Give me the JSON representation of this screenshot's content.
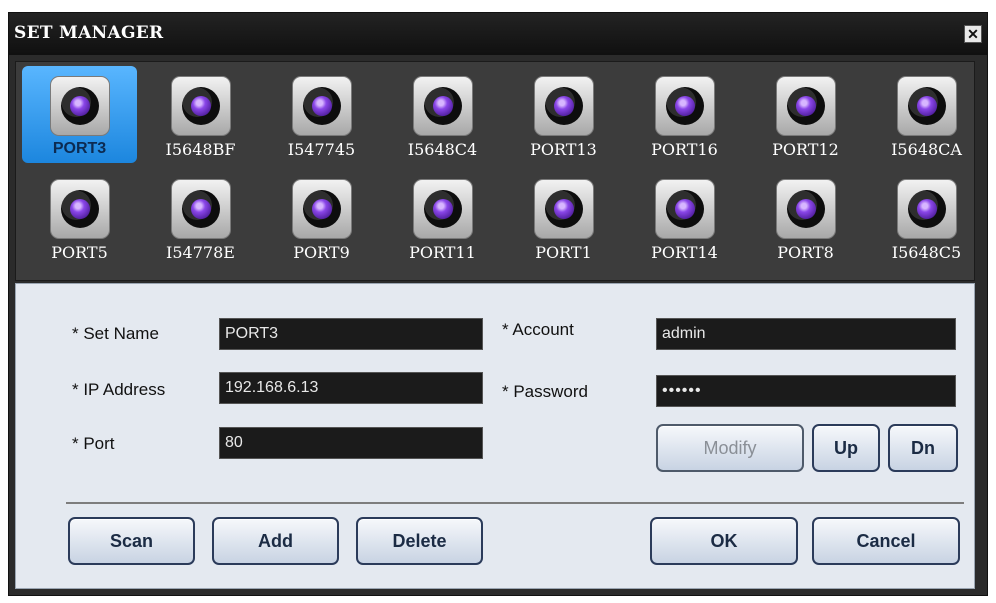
{
  "window": {
    "title": "SET MANAGER",
    "close_icon": "close-icon"
  },
  "devices": [
    {
      "label": "PORT3",
      "selected": true
    },
    {
      "label": "I5648BF"
    },
    {
      "label": "I547745"
    },
    {
      "label": "I5648C4"
    },
    {
      "label": "PORT13"
    },
    {
      "label": "PORT16"
    },
    {
      "label": "PORT12"
    },
    {
      "label": "I5648CA"
    },
    {
      "label": "PORT5"
    },
    {
      "label": "I54778E"
    },
    {
      "label": "PORT9"
    },
    {
      "label": "PORT11"
    },
    {
      "label": "PORT1"
    },
    {
      "label": "PORT14"
    },
    {
      "label": "PORT8"
    },
    {
      "label": "I5648C5"
    }
  ],
  "form": {
    "set_name_label": "* Set Name",
    "set_name_value": "PORT3",
    "ip_label": "* IP Address",
    "ip_value": "192.168.6.13",
    "port_label": "* Port",
    "port_value": "80",
    "account_label": "* Account",
    "account_value": "admin",
    "password_label": "* Password",
    "password_value": "••••••"
  },
  "buttons": {
    "modify": "Modify",
    "up": "Up",
    "dn": "Dn",
    "scan": "Scan",
    "add": "Add",
    "delete": "Delete",
    "ok": "OK",
    "cancel": "Cancel"
  },
  "colors": {
    "selection": "#1c86de",
    "field_bg": "#1b1b1b",
    "panel_bg": "#e4e9f0"
  }
}
